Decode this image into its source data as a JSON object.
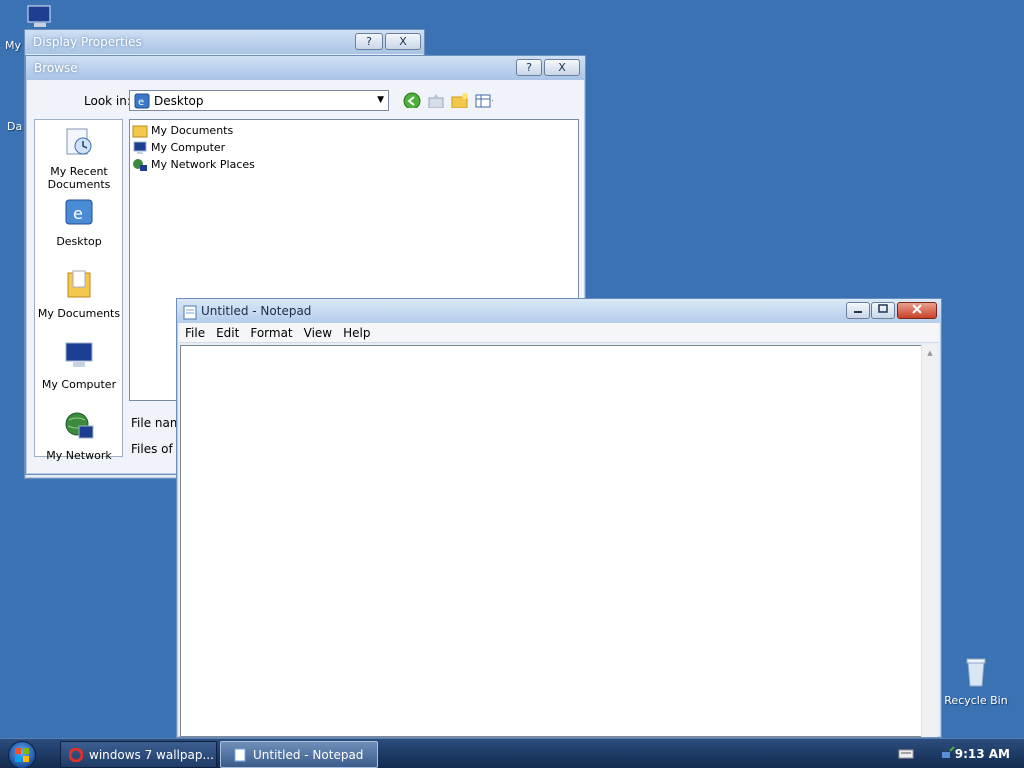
{
  "desktop": {
    "icons": [
      {
        "label": "My"
      },
      {
        "label": "Da"
      },
      {
        "label": "Recycle Bin"
      }
    ]
  },
  "display_properties": {
    "title": "Display Properties",
    "help_btn": "?",
    "close_btn": "X"
  },
  "browse": {
    "title": "Browse",
    "help_btn": "?",
    "close_btn": "X",
    "look_in_label": "Look in:",
    "look_in_value": "Desktop",
    "places": [
      {
        "label": "My Recent Documents"
      },
      {
        "label": "Desktop"
      },
      {
        "label": "My Documents"
      },
      {
        "label": "My Computer"
      },
      {
        "label": "My Network"
      }
    ],
    "files": [
      {
        "label": "My Documents"
      },
      {
        "label": "My Computer"
      },
      {
        "label": "My Network Places"
      }
    ],
    "file_name_label": "File name",
    "files_of_type_label": "Files of ty"
  },
  "notepad": {
    "title": "Untitled - Notepad",
    "menu": [
      "File",
      "Edit",
      "Format",
      "View",
      "Help"
    ],
    "content": ""
  },
  "taskbar": {
    "buttons": [
      {
        "label": "windows 7 wallpap..."
      },
      {
        "label": "Untitled - Notepad"
      }
    ],
    "clock": "9:13 AM"
  },
  "colors": {
    "desktop": "#3a72b4",
    "taskbar": "#1d3a66"
  }
}
